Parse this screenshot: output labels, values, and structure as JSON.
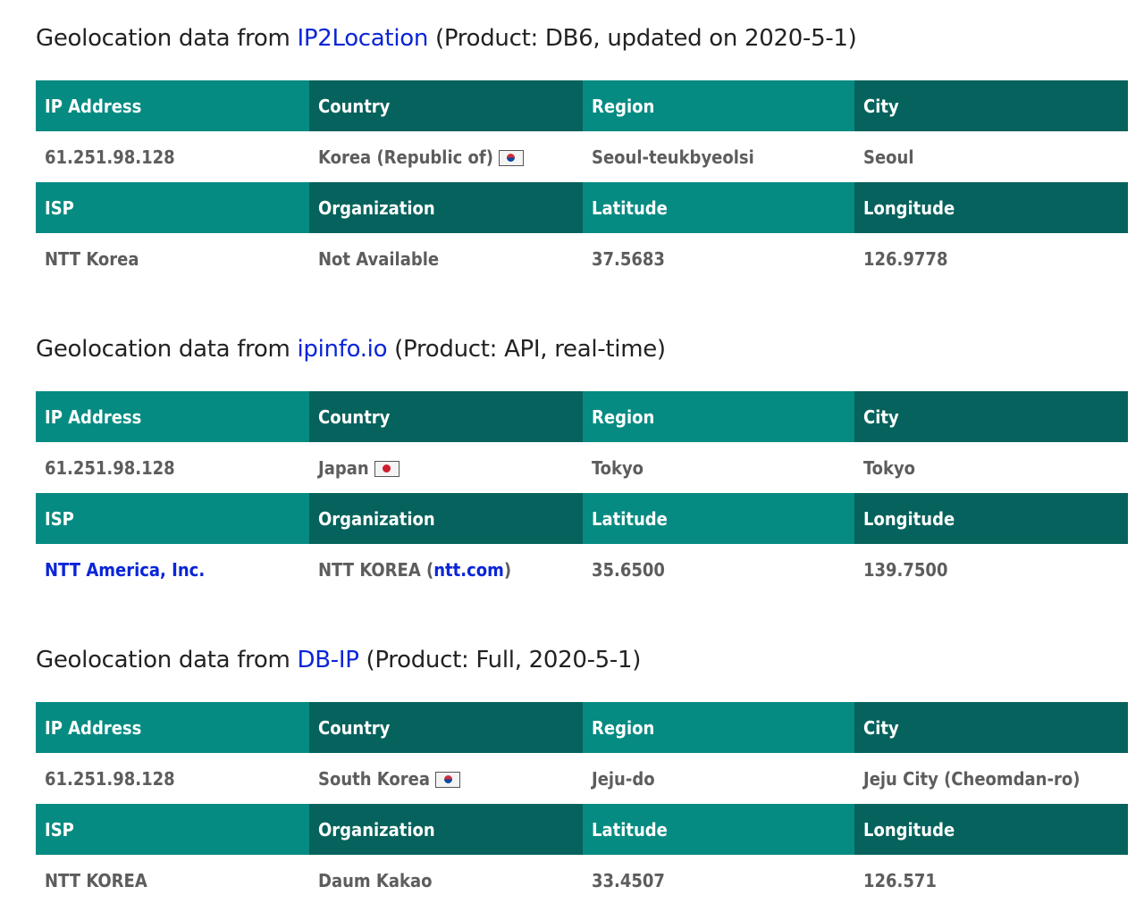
{
  "sections": [
    {
      "heading_prefix": "Geolocation data from ",
      "source_link": "IP2Location",
      "heading_suffix": " (Product: DB6, updated on 2020-5-1)",
      "headers1": [
        "IP Address",
        "Country",
        "Region",
        "City"
      ],
      "row1": {
        "ip": "61.251.98.128",
        "country": "Korea (Republic of)",
        "country_flag": "south-korea-flag-icon",
        "region": "Seoul-teukbyeolsi",
        "city": "Seoul"
      },
      "headers2": [
        "ISP",
        "Organization",
        "Latitude",
        "Longitude"
      ],
      "row2": {
        "isp": "NTT Korea",
        "org": "Not Available",
        "lat": "37.5683",
        "lon": "126.9778"
      }
    },
    {
      "heading_prefix": "Geolocation data from ",
      "source_link": "ipinfo.io",
      "heading_suffix": " (Product: API, real-time)",
      "headers1": [
        "IP Address",
        "Country",
        "Region",
        "City"
      ],
      "row1": {
        "ip": "61.251.98.128",
        "country": "Japan",
        "country_flag": "japan-flag-icon",
        "region": "Tokyo",
        "city": "Tokyo"
      },
      "headers2": [
        "ISP",
        "Organization",
        "Latitude",
        "Longitude"
      ],
      "row2": {
        "isp": "NTT America, Inc.",
        "org_prefix": "NTT KOREA (",
        "org_link": "ntt.com",
        "org_suffix": ")",
        "lat": "35.6500",
        "lon": "139.7500"
      }
    },
    {
      "heading_prefix": "Geolocation data from ",
      "source_link": "DB-IP",
      "heading_suffix": " (Product: Full, 2020-5-1)",
      "headers1": [
        "IP Address",
        "Country",
        "Region",
        "City"
      ],
      "row1": {
        "ip": "61.251.98.128",
        "country": "South Korea",
        "country_flag": "south-korea-flag-icon",
        "region": "Jeju-do",
        "city": "Jeju City (Cheomdan-ro)"
      },
      "headers2": [
        "ISP",
        "Organization",
        "Latitude",
        "Longitude"
      ],
      "row2": {
        "isp": "NTT KOREA",
        "org": "Daum Kakao",
        "lat": "33.4507",
        "lon": "126.571"
      }
    }
  ],
  "colors": {
    "header_teal": "#068b82",
    "header_dark": "#06625c",
    "link": "#0a25d8",
    "cell_text": "#5d5d5d"
  }
}
